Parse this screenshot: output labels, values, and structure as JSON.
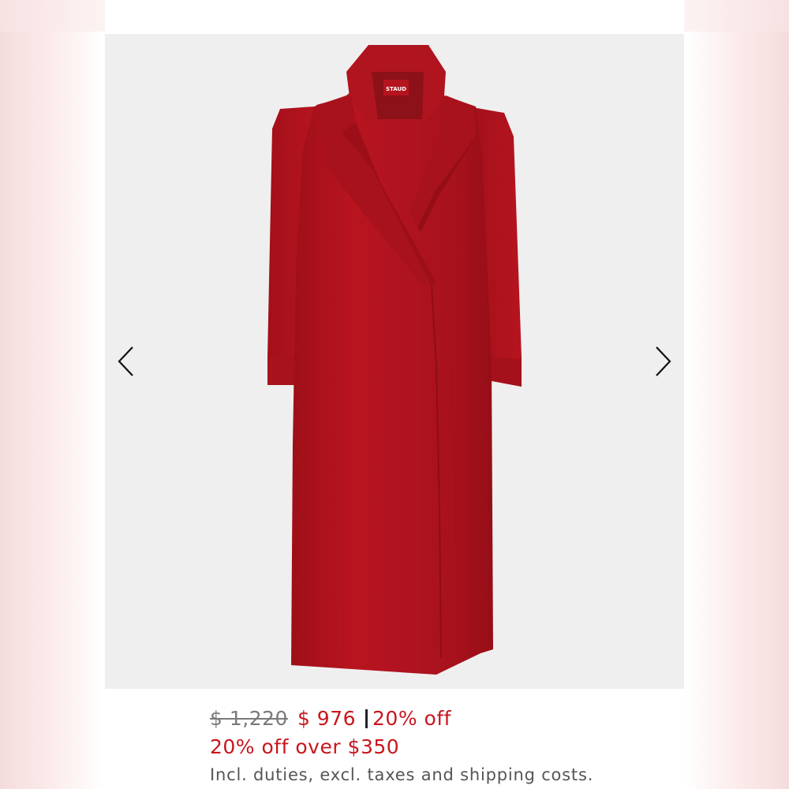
{
  "product": {
    "brand_label": "STAUD",
    "image_icon": "red-long-coat-image"
  },
  "gallery": {
    "prev_icon": "chevron-left-icon",
    "next_icon": "chevron-right-icon"
  },
  "pricing": {
    "original_price": "$ 1,220",
    "sale_price": "$ 976",
    "discount": "20% off",
    "promo": "20% off over $350",
    "tax_note": "Incl. duties, excl. taxes and shipping costs."
  },
  "colors": {
    "sale_red": "#c8161d",
    "coat_red": "#b3141e",
    "gallery_bg": "#efefef"
  }
}
